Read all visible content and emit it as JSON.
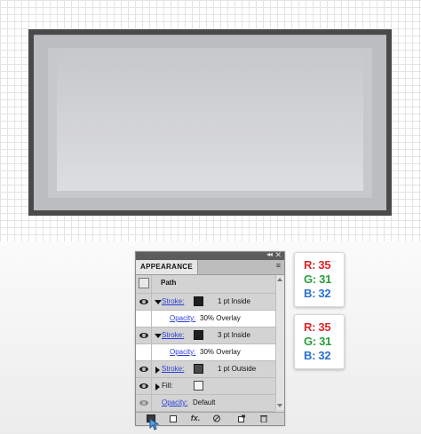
{
  "panel": {
    "tab_label": "APPEARANCE",
    "collapse_glyph": "◂◂",
    "close_glyph": "✕",
    "menu_glyph": "≡",
    "title_row": "Path",
    "rows": [
      {
        "kind": "stroke",
        "label": "Stroke:",
        "swatch": "#1f1f20",
        "value": "1 pt  Inside",
        "expanded": true
      },
      {
        "kind": "opacity",
        "label": "Opacity:",
        "value": "30% Overlay"
      },
      {
        "kind": "stroke",
        "label": "Stroke:",
        "swatch": "#1f1f20",
        "value": "3 pt  Inside",
        "expanded": true
      },
      {
        "kind": "opacity",
        "label": "Opacity:",
        "value": "30% Overlay"
      },
      {
        "kind": "stroke",
        "label": "Stroke:",
        "swatch": "#4a4a4a",
        "value": "1 pt  Outside",
        "expanded": false
      },
      {
        "kind": "fill",
        "label": "Fill:",
        "swatch": "none"
      },
      {
        "kind": "opacity",
        "label": "Opacity:",
        "value": "Default"
      }
    ],
    "bottom_fx": "fx."
  },
  "cards": [
    {
      "r": "R: 35",
      "g": "G: 31",
      "b": "B: 32"
    },
    {
      "r": "R: 35",
      "g": "G: 31",
      "b": "B: 32"
    }
  ],
  "colors": {
    "shape_outer": "#4a4a4a",
    "shape_frame": "#bcbdc0",
    "red_text": "#d9262a",
    "green_text": "#2a9d3d",
    "blue_text": "#2a6fd0",
    "link_blue": "#2c3dd6"
  }
}
